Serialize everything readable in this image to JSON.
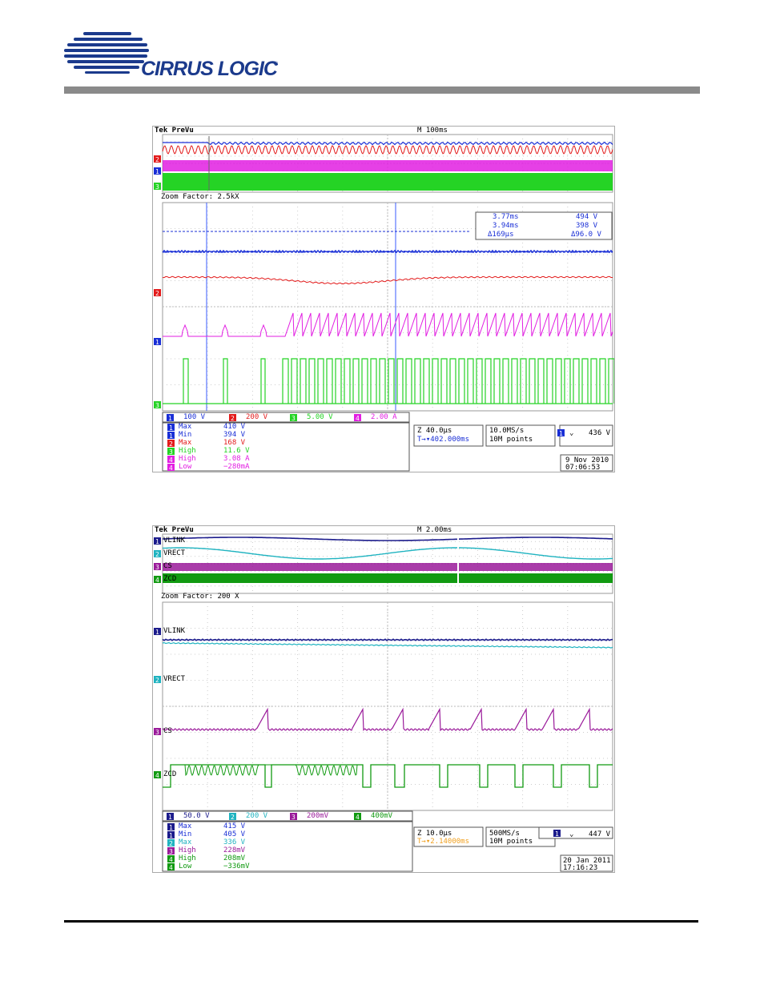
{
  "header": {
    "brand": "CIRRUS LOGIC",
    "brand_mark": "®"
  },
  "colors": {
    "blue": "#1a2fd6",
    "red": "#e31b1b",
    "magenta": "#e21ee2",
    "green": "#25d325",
    "navy": "#1c1c8c",
    "cyan": "#1fb3c0",
    "purple": "#9a1a9a",
    "dkgreen": "#119a11",
    "orange": "#f0a020"
  },
  "chart_data": [
    {
      "type": "line",
      "title": "Tek PreVu",
      "timebase": "M 100ms",
      "zoom_factor": "Zoom Factor: 2.5kX",
      "channels": [
        {
          "id": "1",
          "scale": "100 V",
          "color": "#1a2fd6"
        },
        {
          "id": "2",
          "scale": "200 V",
          "color": "#e31b1b"
        },
        {
          "id": "3",
          "scale": "5.00 V",
          "color": "#25d325"
        },
        {
          "id": "4",
          "scale": "2.00 A",
          "color": "#e21ee2"
        }
      ],
      "cursors": [
        {
          "marker": "a",
          "time": "3.77ms",
          "value": "494 V"
        },
        {
          "marker": "b",
          "time": "3.94ms",
          "value": "398 V"
        },
        {
          "marker": "Δ",
          "time": "Δ169µs",
          "value": "Δ96.0 V"
        }
      ],
      "measurements": [
        {
          "ch": "1",
          "name": "Max",
          "value": "410 V"
        },
        {
          "ch": "1",
          "name": "Min",
          "value": "394 V"
        },
        {
          "ch": "2",
          "name": "Max",
          "value": "168 V"
        },
        {
          "ch": "3",
          "name": "High",
          "value": "11.6 V"
        },
        {
          "ch": "4",
          "name": "High",
          "value": "3.08 A"
        },
        {
          "ch": "4",
          "name": "Low",
          "value": "−280mA"
        }
      ],
      "horizontal": {
        "zoom": "Z 40.0µs",
        "position": "T→▾402.000ms"
      },
      "acquisition": {
        "rate": "10.0MS/s",
        "points": "10M points"
      },
      "trigger": {
        "ch": "1",
        "slope": "⌄",
        "level": "436 V"
      },
      "date": "9 Nov 2010",
      "time": "07:06:53"
    },
    {
      "type": "line",
      "title": "Tek PreVu",
      "timebase": "M 2.00ms",
      "zoom_factor": "Zoom Factor: 200 X",
      "channel_labels": [
        "VLINK",
        "VRECT",
        "CS",
        "ZCD"
      ],
      "channels": [
        {
          "id": "1",
          "scale": "50.0 V",
          "color": "#1c1c8c"
        },
        {
          "id": "2",
          "scale": "200 V",
          "color": "#1fb3c0"
        },
        {
          "id": "3",
          "scale": "200mV",
          "color": "#9a1a9a"
        },
        {
          "id": "4",
          "scale": "400mV",
          "color": "#119a11"
        }
      ],
      "measurements": [
        {
          "ch": "1",
          "name": "Max",
          "value": "415 V"
        },
        {
          "ch": "1",
          "name": "Min",
          "value": "405 V"
        },
        {
          "ch": "2",
          "name": "Max",
          "value": "336 V"
        },
        {
          "ch": "3",
          "name": "High",
          "value": "228mV"
        },
        {
          "ch": "4",
          "name": "High",
          "value": "208mV"
        },
        {
          "ch": "4",
          "name": "Low",
          "value": "−336mV"
        }
      ],
      "horizontal": {
        "zoom": "Z 10.0µs",
        "position": "T→▾2.14000ms"
      },
      "acquisition": {
        "rate": "500MS/s",
        "points": "10M points"
      },
      "trigger": {
        "ch": "1",
        "slope": "⌄",
        "level": "447 V"
      },
      "date": "20 Jan  2011",
      "time": "17:16:23"
    }
  ]
}
